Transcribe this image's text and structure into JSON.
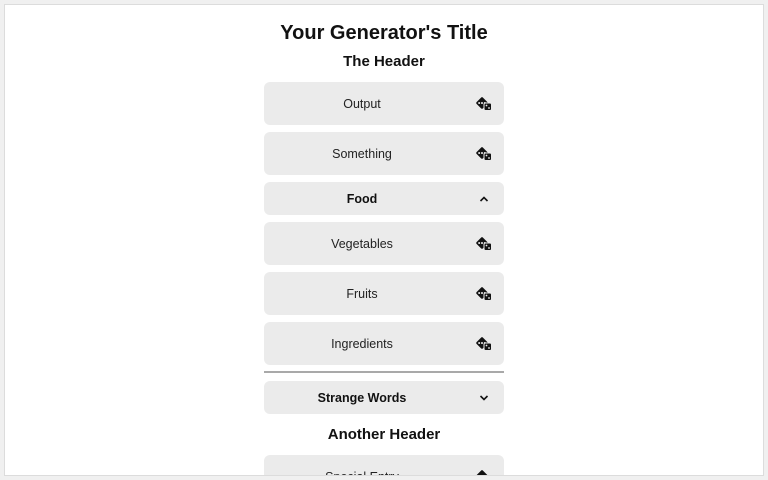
{
  "page": {
    "title": "Your Generator's Title"
  },
  "sections": [
    {
      "header": "The Header",
      "items": [
        {
          "label": "Output",
          "icon": "dice-icon"
        },
        {
          "label": "Something",
          "icon": "dice-icon"
        }
      ]
    }
  ],
  "food_group": {
    "label": "Food",
    "state": "expanded",
    "icon": "chevron-up-icon",
    "items": [
      {
        "label": "Vegetables",
        "icon": "dice-icon"
      },
      {
        "label": "Fruits",
        "icon": "dice-icon"
      },
      {
        "label": "Ingredients",
        "icon": "dice-icon"
      }
    ]
  },
  "strange_group": {
    "label": "Strange Words",
    "state": "collapsed",
    "icon": "chevron-down-icon"
  },
  "another_section": {
    "header": "Another Header",
    "items": [
      {
        "label": "Special Entry",
        "icon": "dice-icon"
      }
    ]
  },
  "colors": {
    "row_background": "#ebebeb",
    "page_background": "#ffffff",
    "divider": "#a9a9a9",
    "text": "#111111"
  }
}
